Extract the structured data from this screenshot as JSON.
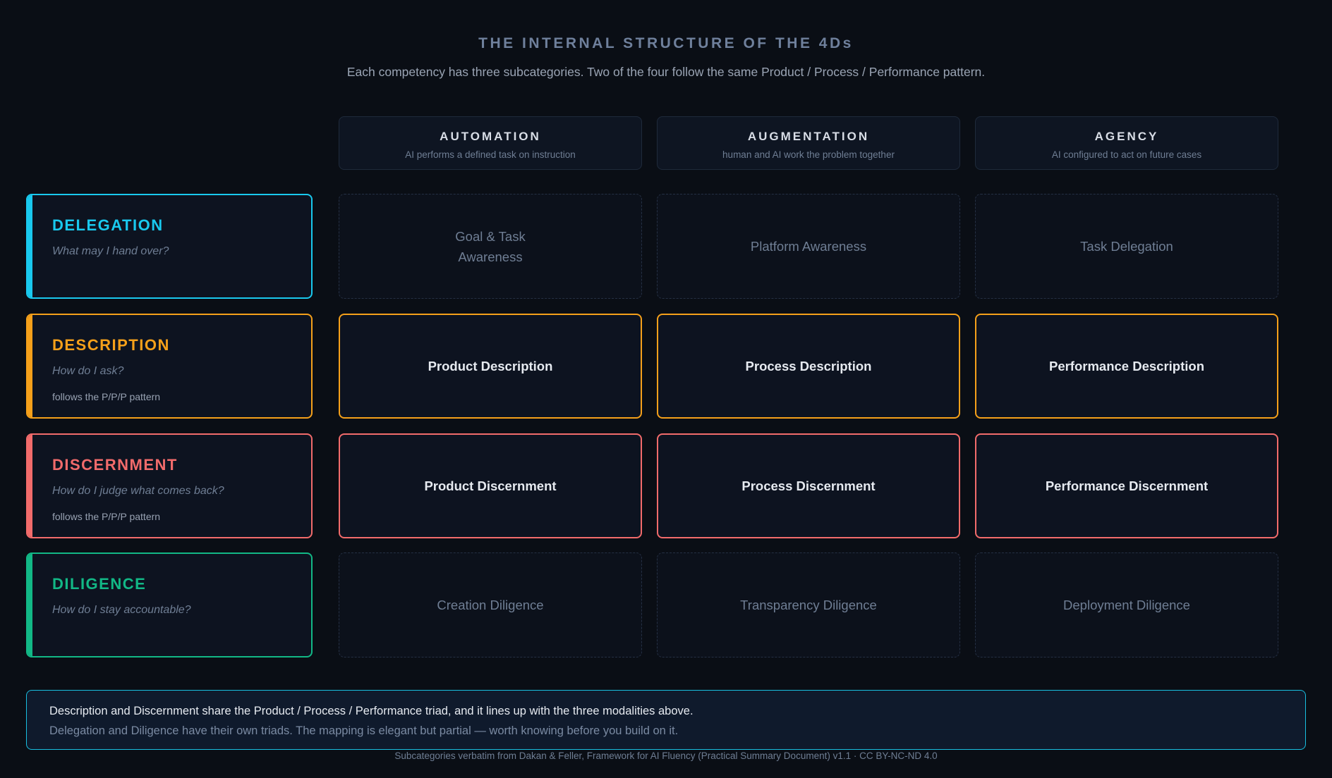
{
  "header": {
    "title": "THE INTERNAL STRUCTURE OF THE 4Ds",
    "subtitle": "Each competency has three subcategories. Two of the four follow the same Product / Process / Performance pattern."
  },
  "columns": [
    {
      "name": "AUTOMATION",
      "desc": "AI performs a defined task on instruction"
    },
    {
      "name": "AUGMENTATION",
      "desc": "human and AI work the problem together"
    },
    {
      "name": "AGENCY",
      "desc": "AI configured to act on future cases"
    }
  ],
  "rows": [
    {
      "name": "DELEGATION",
      "question": "What may I hand over?",
      "note": "",
      "color": "#19c9ee",
      "style": "dashed",
      "cells": [
        "Goal & Task\nAwareness",
        "Platform Awareness",
        "Task Delegation"
      ]
    },
    {
      "name": "DESCRIPTION",
      "question": "How do I ask?",
      "note": "follows the P/P/P pattern",
      "color": "#f5a01a",
      "style": "solid",
      "cells": [
        "Product Description",
        "Process Description",
        "Performance Description"
      ]
    },
    {
      "name": "DISCERNMENT",
      "question": "How do I judge what comes back?",
      "note": "follows the P/P/P pattern",
      "color": "#f26b6b",
      "style": "solid",
      "cells": [
        "Product Discernment",
        "Process Discernment",
        "Performance Discernment"
      ]
    },
    {
      "name": "DILIGENCE",
      "question": "How do I stay accountable?",
      "note": "",
      "color": "#12b886",
      "style": "dashed",
      "cells": [
        "Creation Diligence",
        "Transparency Diligence",
        "Deployment Diligence"
      ]
    }
  ],
  "footer": {
    "line1": "Description and Discernment share the Product / Process / Performance triad, and it lines up with the three modalities above.",
    "line2": "Delegation and Diligence have their own triads. The mapping is elegant but partial — worth knowing before you build on it.",
    "credit": "Subcategories verbatim from Dakan & Feller, Framework for AI Fluency (Practical Summary Document) v1.1 · CC BY-NC-ND 4.0"
  }
}
